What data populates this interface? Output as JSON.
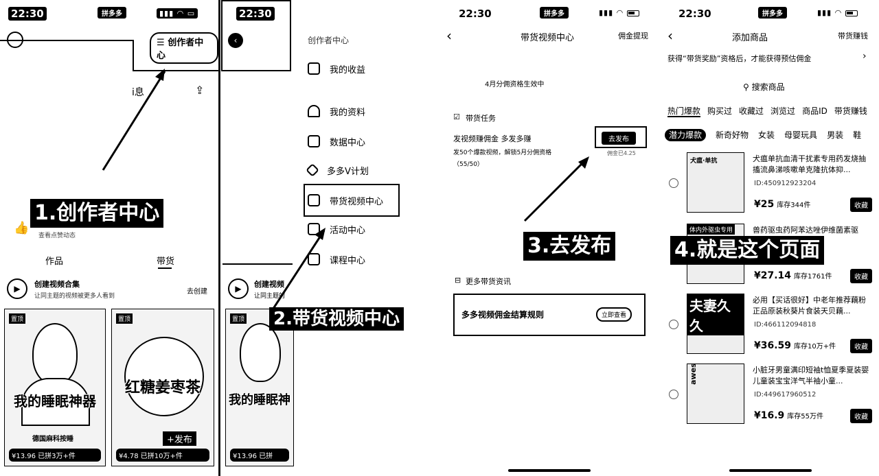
{
  "status": {
    "time": "22:30",
    "app": "拼多多"
  },
  "panel1": {
    "creator_btn": "创作者中心",
    "msg_frag": "i息",
    "like_text": "查看点赞动态",
    "tabs": [
      "作品",
      "带货"
    ],
    "create_title": "创建视频合集",
    "create_sub": "让同主题的视频被更多人看到",
    "create_btn": "去创建",
    "videos": [
      {
        "tag": "置顶",
        "title": "我的睡眠神器",
        "brand": "德国麻科按睡",
        "price": "¥13.96 已拼3万+件"
      },
      {
        "tag": "置顶",
        "title": "红糖姜枣茶",
        "brand": "",
        "price": "¥4.78 已拼10万+件",
        "publish": "发布"
      }
    ],
    "label": "1.创作者中心"
  },
  "panel2": {
    "title": "创作者中心",
    "menu": [
      "我的收益",
      "我的资料",
      "数据中心",
      "多多V计划",
      "带货视频中心",
      "活动中心",
      "课程中心"
    ],
    "create_title": "创建视频",
    "create_sub": "让同主题的",
    "video": {
      "tag": "置顶",
      "title": "我的睡眠神",
      "price": "¥13.96 已拼"
    },
    "label": "2.带货视频中心"
  },
  "panel3": {
    "title": "带货视频中心",
    "right": "佣金提现",
    "notice": "4月分佣资格生效中",
    "task_title": "带货任务",
    "task_name": "发视频赚佣金 多发多赚",
    "task_desc": "发50个爆款视频，解锁5月分佣资格",
    "task_progress": "（55/50）",
    "publish_btn": "去发布",
    "reward_frag": "佣金已4.25",
    "more_title": "更多带货资讯",
    "banner_text": "多多视频佣金结算规则",
    "banner_btn": "立即查看",
    "label": "3.去发布"
  },
  "panel4": {
    "title": "添加商品",
    "right": "带货赚钱",
    "notice": "获得“带货奖励”资格后，才能获得预估佣金",
    "search": "搜索商品",
    "tabs": [
      "热门爆款",
      "购买过",
      "收藏过",
      "浏览过",
      "商品ID",
      "带货赚钱"
    ],
    "cats": [
      "潜力爆款",
      "新奇好物",
      "女装",
      "母婴玩具",
      "男装",
      "鞋"
    ],
    "products": [
      {
        "title": "犬瘟单抗血清干扰素专用药发烧抽搐流鼻涕咳嗽单克隆抗体抑...",
        "id": "ID:450912923204",
        "price": "¥25",
        "stock": "库存344件",
        "img_text": "犬瘟·单抗"
      },
      {
        "title": "兽药驱虫药阿苯达唑伊维菌素驱",
        "id": "",
        "price": "¥27.14",
        "stock": "库存1761件",
        "img_text": "体内外驱虫专用"
      },
      {
        "title": "必用【买话很好】中老年推荐藕粉正品原装秋葵片食装天贝藕...",
        "id": "ID:466112094818",
        "price": "¥36.59",
        "stock": "库存10万+件",
        "img_text": "夫妻久久"
      },
      {
        "title": "小脏牙男童满印短袖t恤夏季夏装婴儿童装宝宝洋气半袖小童...",
        "id": "ID:449617960512",
        "price": "¥16.9",
        "stock": "库存55万件",
        "img_text": "awesome"
      }
    ],
    "collect": "收藏",
    "label": "4.就是这个页面"
  }
}
